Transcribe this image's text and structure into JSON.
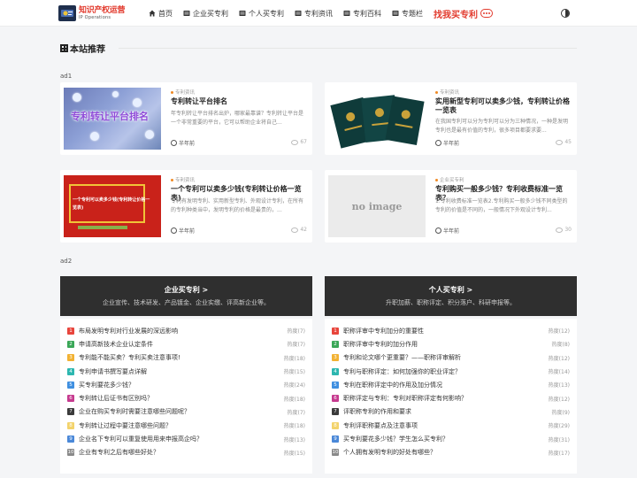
{
  "header": {
    "logo_main": "知识产权运营",
    "logo_sub": "IP Operations",
    "nav": [
      {
        "label": "首页"
      },
      {
        "label": "企业买专利"
      },
      {
        "label": "个人买专利"
      },
      {
        "label": "专利资讯"
      },
      {
        "label": "专利百科"
      },
      {
        "label": "专题栏"
      }
    ],
    "hot_label": "找我买专利"
  },
  "section": {
    "title": "本站推荐"
  },
  "ads": {
    "ad1": "ad1",
    "ad2": "ad2"
  },
  "cards": [
    {
      "category": "专利资讯",
      "title": "专利转让平台排名",
      "excerpt": "年专利转让平台排名出炉，哪家最靠谱？专利转让平台是一个非常重要的平台，它可以帮助企业将自己...",
      "date": "半年前",
      "views": "67",
      "thumb_text": "专利转让平台排名"
    },
    {
      "category": "专利资讯",
      "title": "实用新型专利可以卖多少钱，专利转让价格一览表",
      "excerpt": "在我国专利可以分为专利可以分为三种情况，一种是发明专利也是最有价值的专利，很多项目都要求要...",
      "date": "半年前",
      "views": "45",
      "thumb_text": ""
    },
    {
      "category": "专利资讯",
      "title": "一个专利可以卖多少钱(专利转让价格一览表)",
      "excerpt": "专利有发明专利、实用新型专利、外观设计专利，在所有的专利种类当中，发明专利的价格是最贵的，...",
      "date": "半年前",
      "views": "42",
      "thumb_text": "一个专利可以卖多少钱(专利转让价格一览表)"
    },
    {
      "category": "企业买专利",
      "title": "专利购买一般多少钱？专利收费标准一览表？",
      "excerpt": "1.专利收费标准一览表2.专利购买一般多少钱不同类型的专利的价值是不同的，一般情况下外观设计专利...",
      "date": "半年前",
      "views": "30",
      "thumb_text": "no image"
    }
  ],
  "blocks": [
    {
      "title": "企业买专利 >",
      "desc": "企业宣传、技术研发、产品镀金、企业实缴、评高新企业等。",
      "items": [
        {
          "num": "1",
          "title": "布局发明专利对行业发展的深远影响",
          "heat": "热度(7)"
        },
        {
          "num": "2",
          "title": "申请高新技术企业认定条件",
          "heat": "热度(7)"
        },
        {
          "num": "3",
          "title": "专利能不能买卖？专利买卖注意事项!",
          "heat": "热度(18)"
        },
        {
          "num": "4",
          "title": "专利申请书撰写要点详解",
          "heat": "热度(15)"
        },
        {
          "num": "5",
          "title": "买专利要花多少钱？",
          "heat": "热度(24)"
        },
        {
          "num": "6",
          "title": "专利转让后证书有区别吗？",
          "heat": "热度(18)"
        },
        {
          "num": "7",
          "title": "企业在购买专利时需要注意哪些问题呢？",
          "heat": "热度(7)"
        },
        {
          "num": "8",
          "title": "专利转让过程中要注意哪些问题？",
          "heat": "热度(18)"
        },
        {
          "num": "9",
          "title": "企业名下专利可以重复使用用来申报高企吗？",
          "heat": "热度(13)"
        },
        {
          "num": "10",
          "title": "企业有专利之后有哪些好处？",
          "heat": "热度(15)"
        }
      ]
    },
    {
      "title": "个人买专利 >",
      "desc": "升职加薪、职称评定、积分落户、科研申报等。",
      "items": [
        {
          "num": "1",
          "title": "职称评审中专利加分的重要性",
          "heat": "热度(12)"
        },
        {
          "num": "2",
          "title": "职称评审中专利的加分作用",
          "heat": "热度(8)"
        },
        {
          "num": "3",
          "title": "专利和论文哪个更重要？——职称评审解析",
          "heat": "热度(12)"
        },
        {
          "num": "4",
          "title": "专利与职称评定：如何加强你的职业评定？",
          "heat": "热度(14)"
        },
        {
          "num": "5",
          "title": "专利在职称评定中的作用及加分情况",
          "heat": "热度(13)"
        },
        {
          "num": "6",
          "title": "职称评定与专利：专利对职称评定有何影响？",
          "heat": "热度(12)"
        },
        {
          "num": "7",
          "title": "评职称专利的作用和要求",
          "heat": "热度(9)"
        },
        {
          "num": "8",
          "title": "专利评职称要点及注意事项",
          "heat": "热度(29)"
        },
        {
          "num": "9",
          "title": "买专利要花多少钱？学生怎么买专利？",
          "heat": "热度(31)"
        },
        {
          "num": "10",
          "title": "个人拥有发明专利的好处有哪些？",
          "heat": "热度(17)"
        }
      ]
    }
  ],
  "colors": {
    "accent": "#e23b2e",
    "rank": [
      "#e8453c",
      "#3aa757",
      "#f2b233",
      "#2db7b0",
      "#3f8fe0",
      "#c63a8f",
      "#3b3b3b",
      "#f3d36b",
      "#4a88d8",
      "#8a8a8a"
    ]
  }
}
